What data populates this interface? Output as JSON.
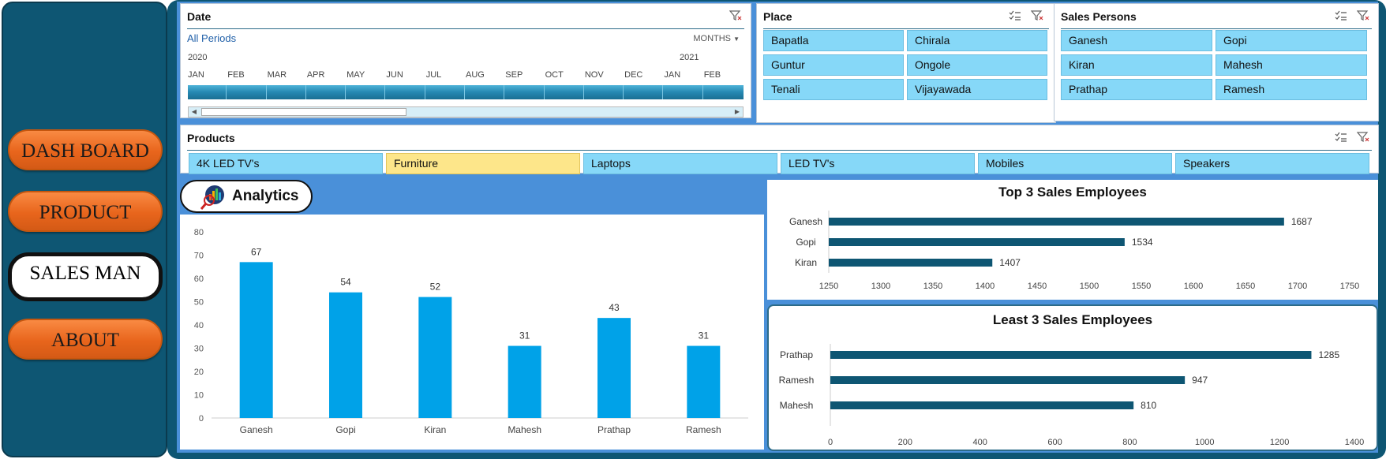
{
  "nav": {
    "items": [
      {
        "label": "DASH BOARD",
        "active": false
      },
      {
        "label": "PRODUCT",
        "active": false
      },
      {
        "label": "SALES MAN",
        "active": true
      },
      {
        "label": "ABOUT",
        "active": false
      }
    ]
  },
  "date_slicer": {
    "title": "Date",
    "period": "All Periods",
    "level": "MONTHS",
    "years": [
      "2020",
      "2021"
    ],
    "months": [
      "JAN",
      "FEB",
      "MAR",
      "APR",
      "MAY",
      "JUN",
      "JUL",
      "AUG",
      "SEP",
      "OCT",
      "NOV",
      "DEC",
      "JAN",
      "FEB"
    ]
  },
  "place_slicer": {
    "title": "Place",
    "items": [
      "Bapatla",
      "Chirala",
      "Guntur",
      "Ongole",
      "Tenali",
      "Vijayawada"
    ]
  },
  "sales_slicer": {
    "title": "Sales Persons",
    "items": [
      "Ganesh",
      "Gopi",
      "Kiran",
      "Mahesh",
      "Prathap",
      "Ramesh"
    ]
  },
  "products_slicer": {
    "title": "Products",
    "items": [
      {
        "label": "4K LED TV's",
        "selected": false
      },
      {
        "label": "Furniture",
        "selected": true
      },
      {
        "label": "Laptops",
        "selected": false
      },
      {
        "label": "LED TV's",
        "selected": false
      },
      {
        "label": "Mobiles",
        "selected": false
      },
      {
        "label": "Speakers",
        "selected": false
      }
    ]
  },
  "analytics": {
    "label": "Analytics"
  },
  "colors": {
    "bar_blue": "#00a2e8",
    "bar_dark": "#0e5673",
    "accent_orange": "#e8651c",
    "chip_blue": "#86d8f8",
    "chip_selected": "#fde68a"
  },
  "chart_data": [
    {
      "type": "bar",
      "categories": [
        "Ganesh",
        "Gopi",
        "Kiran",
        "Mahesh",
        "Prathap",
        "Ramesh"
      ],
      "values": [
        67,
        54,
        52,
        31,
        43,
        31
      ],
      "title": "",
      "ylim": [
        0,
        80
      ],
      "yticks": [
        0,
        10,
        20,
        30,
        40,
        50,
        60,
        70,
        80
      ]
    },
    {
      "type": "bar",
      "orientation": "horizontal",
      "title": "Top 3 Sales Employees",
      "categories": [
        "Ganesh",
        "Gopi",
        "Kiran"
      ],
      "values": [
        1687,
        1534,
        1407
      ],
      "xlim": [
        1250,
        1750
      ],
      "xticks": [
        1250,
        1300,
        1350,
        1400,
        1450,
        1500,
        1550,
        1600,
        1650,
        1700,
        1750
      ]
    },
    {
      "type": "bar",
      "orientation": "horizontal",
      "title": "Least 3 Sales Employees",
      "categories": [
        "Prathap",
        "Ramesh",
        "Mahesh"
      ],
      "values": [
        1285,
        947,
        810
      ],
      "xlim": [
        0,
        1400
      ],
      "xticks": [
        0,
        200,
        400,
        600,
        800,
        1000,
        1200,
        1400
      ]
    }
  ]
}
